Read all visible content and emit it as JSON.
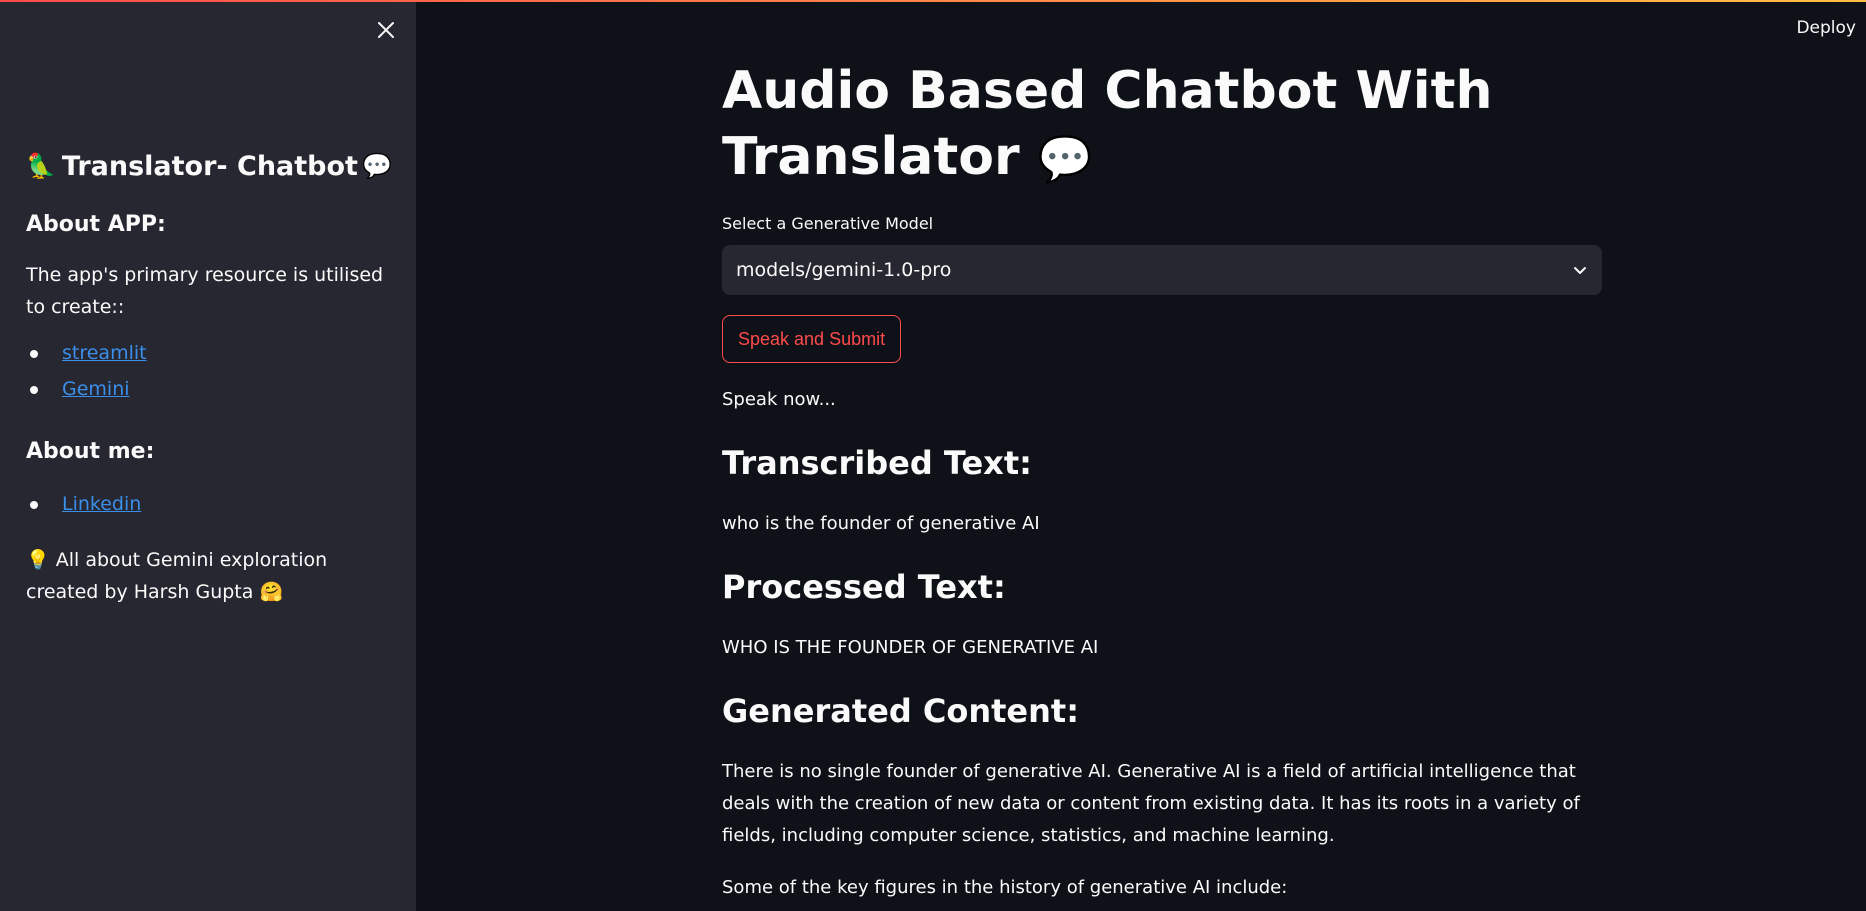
{
  "sidebar": {
    "title": "Translator- Chatbot",
    "title_emoji_left": "🦜",
    "title_emoji_right": "💬",
    "about_app_heading": "About APP:",
    "about_app_text": "The app's primary resource is utilised to create::",
    "app_links": [
      {
        "label": "streamlit"
      },
      {
        "label": "Gemini"
      }
    ],
    "about_me_heading": "About me:",
    "me_links": [
      {
        "label": "Linkedin"
      }
    ],
    "footer_prefix_emoji": "💡",
    "footer_text": "All about Gemini exploration created by Harsh Gupta",
    "footer_suffix_emoji": "🤗"
  },
  "header": {
    "deploy_label": "Deploy"
  },
  "main": {
    "title_line1": "Audio Based Chatbot With",
    "title_line2": "Translator",
    "title_emoji": "💬",
    "model_label": "Select a Generative Model",
    "model_value": "models/gemini-1.0-pro",
    "speak_button": "Speak and Submit",
    "status_text": "Speak now...",
    "transcribed_heading": "Transcribed Text:",
    "transcribed_text": "who is the founder of generative AI",
    "processed_heading": "Processed Text:",
    "processed_text": "WHO IS THE FOUNDER OF GENERATIVE AI",
    "generated_heading": "Generated Content:",
    "generated_para1": "There is no single founder of generative AI. Generative AI is a field of artificial intelligence that deals with the creation of new data or content from existing data. It has its roots in a variety of fields, including computer science, statistics, and machine learning.",
    "generated_para2": "Some of the key figures in the history of generative AI include:"
  },
  "colors": {
    "background": "#0e1117",
    "sidebar": "#262730",
    "accent": "#ff4b4b",
    "link": "#3b8eea"
  }
}
